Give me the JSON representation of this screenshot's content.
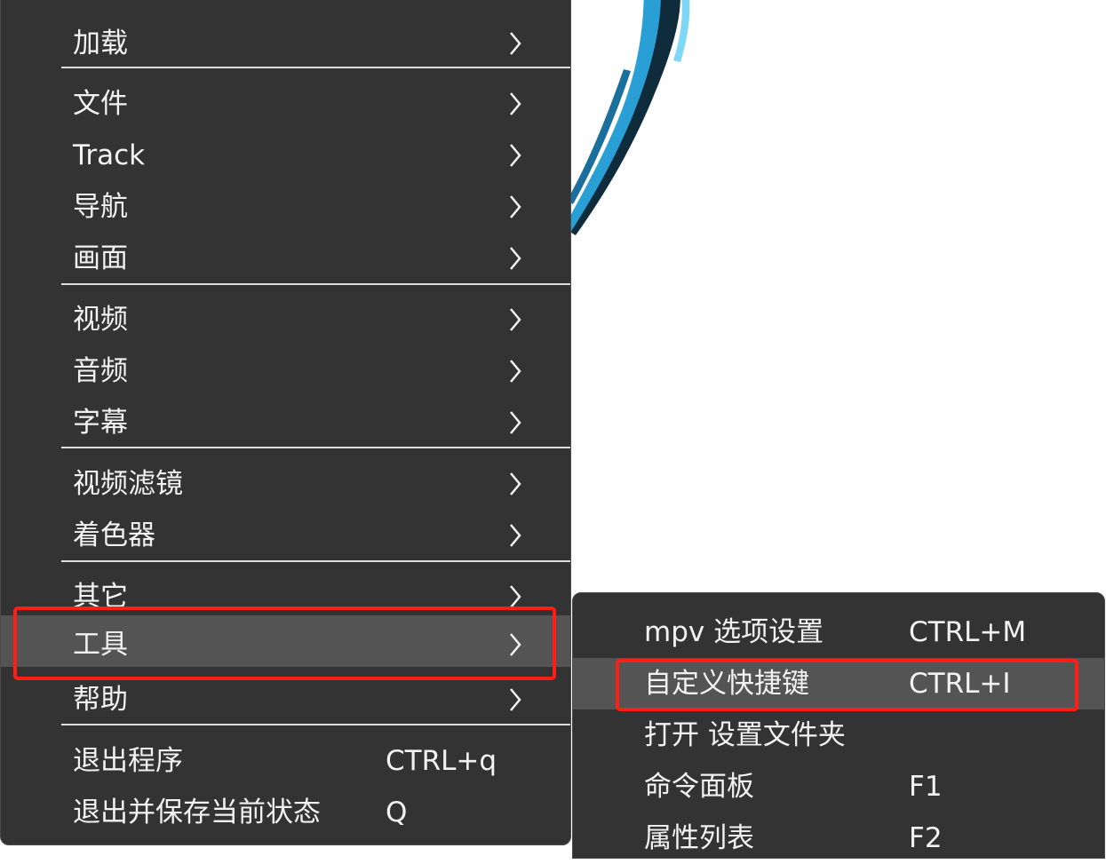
{
  "main_menu": {
    "items": [
      {
        "label": "加载"
      },
      {
        "label": "文件"
      },
      {
        "label": "Track"
      },
      {
        "label": "导航"
      },
      {
        "label": "画面"
      },
      {
        "label": "视频"
      },
      {
        "label": "音频"
      },
      {
        "label": "字幕"
      },
      {
        "label": "视频滤镜"
      },
      {
        "label": "着色器"
      },
      {
        "label": "其它"
      },
      {
        "label": "工具"
      },
      {
        "label": "帮助"
      },
      {
        "label": "退出程序",
        "shortcut": "CTRL+q"
      },
      {
        "label": "退出并保存当前状态",
        "shortcut": "Q"
      }
    ],
    "highlighted": "工具"
  },
  "tools_submenu": {
    "items": [
      {
        "label": "mpv 选项设置",
        "shortcut": "CTRL+M"
      },
      {
        "label": "自定义快捷键",
        "shortcut": "CTRL+I"
      },
      {
        "label": "打开 设置文件夹"
      },
      {
        "label": "命令面板",
        "shortcut": "F1"
      },
      {
        "label": "属性列表",
        "shortcut": "F2"
      }
    ],
    "highlighted": "自定义快捷键"
  },
  "icons": {
    "submenu_arrow": "chevron-right-icon"
  },
  "colors": {
    "menu_bg": "#333333",
    "menu_highlight": "#545454",
    "annotation_box": "#ff1e16",
    "background_art_blue": "#2a9fd6"
  }
}
